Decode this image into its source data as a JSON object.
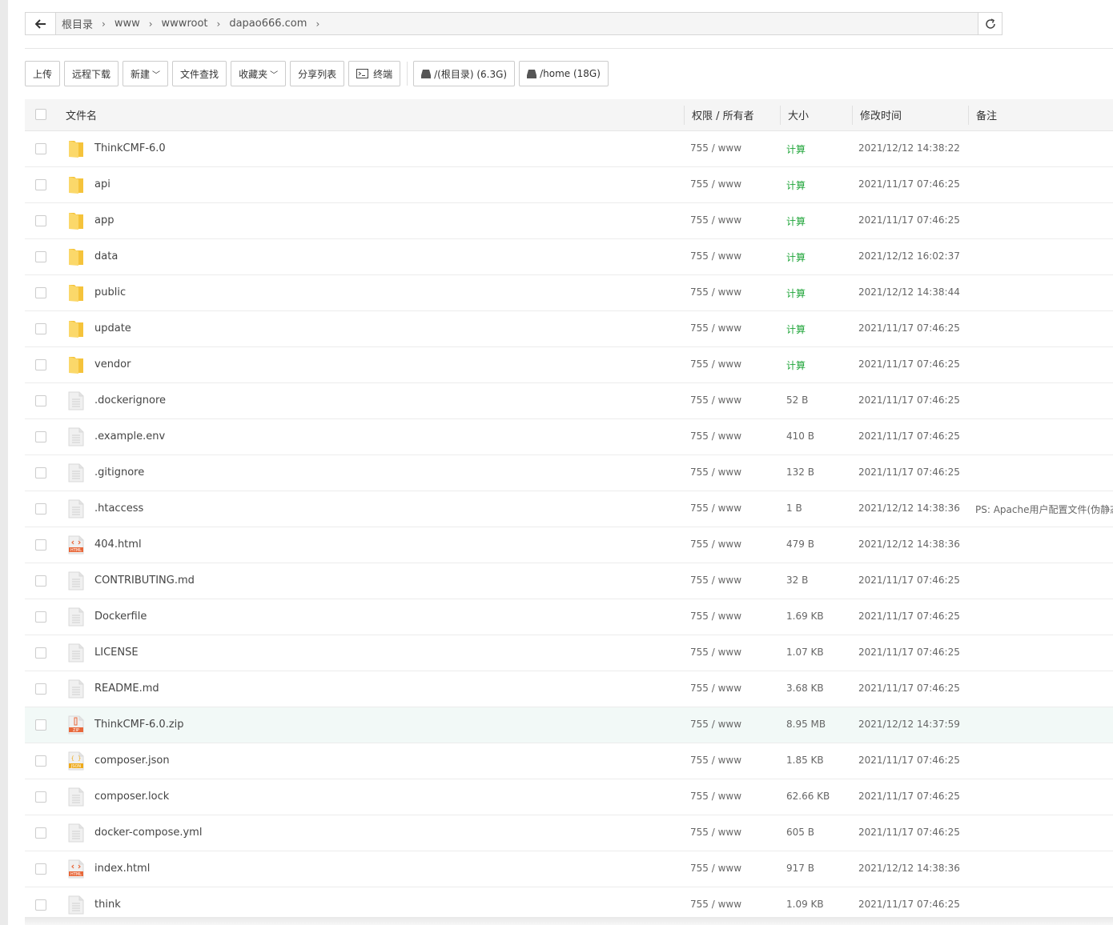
{
  "breadcrumb": [
    "根目录",
    "www",
    "wwwroot",
    "dapao666.com"
  ],
  "toolbar": {
    "upload": "上传",
    "remote_download": "远程下载",
    "new": "新建",
    "search": "文件查找",
    "favorites": "收藏夹",
    "share_list": "分享列表",
    "terminal": "终端",
    "disk_root": "/(根目录) (6.3G)",
    "disk_home": "/home (18G)"
  },
  "columns": {
    "name": "文件名",
    "perm": "权限 / 所有者",
    "size": "大小",
    "mtime": "修改时间",
    "note": "备注"
  },
  "files": [
    {
      "name": "ThinkCMF-6.0",
      "perm": "755 / www",
      "size": "计算",
      "mtime": "2021/12/12 14:38:22",
      "note": "",
      "type": "folder"
    },
    {
      "name": "api",
      "perm": "755 / www",
      "size": "计算",
      "mtime": "2021/11/17 07:46:25",
      "note": "",
      "type": "folder"
    },
    {
      "name": "app",
      "perm": "755 / www",
      "size": "计算",
      "mtime": "2021/11/17 07:46:25",
      "note": "",
      "type": "folder"
    },
    {
      "name": "data",
      "perm": "755 / www",
      "size": "计算",
      "mtime": "2021/12/12 16:02:37",
      "note": "",
      "type": "folder"
    },
    {
      "name": "public",
      "perm": "755 / www",
      "size": "计算",
      "mtime": "2021/12/12 14:38:44",
      "note": "",
      "type": "folder"
    },
    {
      "name": "update",
      "perm": "755 / www",
      "size": "计算",
      "mtime": "2021/11/17 07:46:25",
      "note": "",
      "type": "folder"
    },
    {
      "name": "vendor",
      "perm": "755 / www",
      "size": "计算",
      "mtime": "2021/11/17 07:46:25",
      "note": "",
      "type": "folder"
    },
    {
      "name": ".dockerignore",
      "perm": "755 / www",
      "size": "52 B",
      "mtime": "2021/11/17 07:46:25",
      "note": "",
      "type": "file"
    },
    {
      "name": ".example.env",
      "perm": "755 / www",
      "size": "410 B",
      "mtime": "2021/11/17 07:46:25",
      "note": "",
      "type": "file"
    },
    {
      "name": ".gitignore",
      "perm": "755 / www",
      "size": "132 B",
      "mtime": "2021/11/17 07:46:25",
      "note": "",
      "type": "file"
    },
    {
      "name": ".htaccess",
      "perm": "755 / www",
      "size": "1 B",
      "mtime": "2021/12/12 14:38:36",
      "note": "PS: Apache用户配置文件(伪静态",
      "type": "file"
    },
    {
      "name": "404.html",
      "perm": "755 / www",
      "size": "479 B",
      "mtime": "2021/12/12 14:38:36",
      "note": "",
      "type": "html"
    },
    {
      "name": "CONTRIBUTING.md",
      "perm": "755 / www",
      "size": "32 B",
      "mtime": "2021/11/17 07:46:25",
      "note": "",
      "type": "file"
    },
    {
      "name": "Dockerfile",
      "perm": "755 / www",
      "size": "1.69 KB",
      "mtime": "2021/11/17 07:46:25",
      "note": "",
      "type": "file"
    },
    {
      "name": "LICENSE",
      "perm": "755 / www",
      "size": "1.07 KB",
      "mtime": "2021/11/17 07:46:25",
      "note": "",
      "type": "file"
    },
    {
      "name": "README.md",
      "perm": "755 / www",
      "size": "3.68 KB",
      "mtime": "2021/11/17 07:46:25",
      "note": "",
      "type": "file"
    },
    {
      "name": "ThinkCMF-6.0.zip",
      "perm": "755 / www",
      "size": "8.95 MB",
      "mtime": "2021/12/12 14:37:59",
      "note": "",
      "type": "zip",
      "highlight": true
    },
    {
      "name": "composer.json",
      "perm": "755 / www",
      "size": "1.85 KB",
      "mtime": "2021/11/17 07:46:25",
      "note": "",
      "type": "json"
    },
    {
      "name": "composer.lock",
      "perm": "755 / www",
      "size": "62.66 KB",
      "mtime": "2021/11/17 07:46:25",
      "note": "",
      "type": "file"
    },
    {
      "name": "docker-compose.yml",
      "perm": "755 / www",
      "size": "605 B",
      "mtime": "2021/11/17 07:46:25",
      "note": "",
      "type": "file"
    },
    {
      "name": "index.html",
      "perm": "755 / www",
      "size": "917 B",
      "mtime": "2021/12/12 14:38:36",
      "note": "",
      "type": "html"
    },
    {
      "name": "think",
      "perm": "755 / www",
      "size": "1.09 KB",
      "mtime": "2021/11/17 07:46:25",
      "note": "",
      "type": "file"
    }
  ],
  "icon_labels": {
    "html": "HTML",
    "zip": "ZIP",
    "json": "JSON"
  },
  "colors": {
    "calc": "#20a53a",
    "folder": "#f5c33b",
    "html_badge": "#e8683a",
    "zip_badge": "#e8683a",
    "json_badge": "#eeaa1b"
  }
}
